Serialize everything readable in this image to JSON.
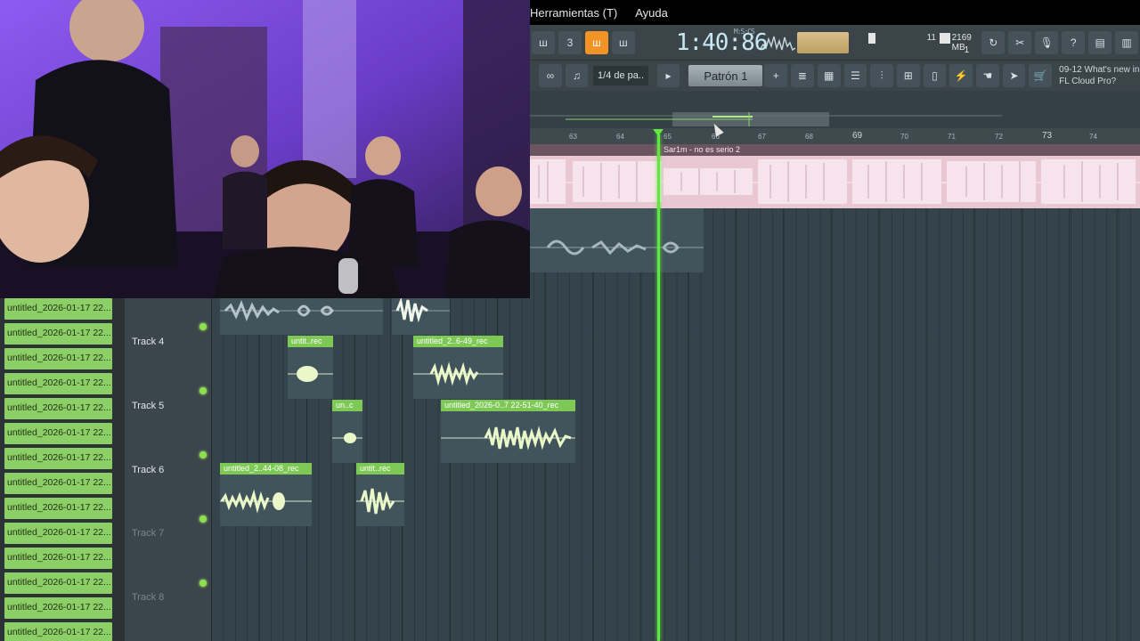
{
  "menu": {
    "items": [
      "Herramientas (T)",
      "Ayuda"
    ]
  },
  "transport": {
    "time": "1:40:86",
    "time_format": "M:S:CS",
    "cpu_value": "11",
    "memory": "2169 MB",
    "polyphony": "1"
  },
  "toolbar2": {
    "snap_label": "1/4 de pa..",
    "pattern_label": "Patrón 1",
    "pattern_add": "+",
    "news_date": "09-12",
    "news_text": "What's new in FL Cloud Pro?"
  },
  "ruler": {
    "bars": [
      "63",
      "64",
      "65",
      "66",
      "67",
      "68",
      "69",
      "70",
      "71",
      "72",
      "73",
      "74"
    ]
  },
  "master_clip": {
    "label": "Sar1m - no es serio 2"
  },
  "sidebar": {
    "items": [
      "untitled_2026-01-17 22...",
      "untitled_2026-01-17 22...",
      "untitled_2026-01-17 22...",
      "untitled_2026-01-17 22...",
      "untitled_2026-01-17 22...",
      "untitled_2026-01-17 22...",
      "untitled_2026-01-17 22...",
      "untitled_2026-01-17 22...",
      "untitled_2026-01-17 22...",
      "untitled_2026-01-17 22...",
      "untitled_2026-01-17 22...",
      "untitled_2026-01-17 22...",
      "untitled_2026-01-17 22...",
      "untitled_2026-01-17 22..."
    ]
  },
  "tracks": [
    {
      "name": "Track 4"
    },
    {
      "name": "Track 5"
    },
    {
      "name": "Track 6"
    },
    {
      "name": "Track 7"
    },
    {
      "name": "Track 8"
    }
  ],
  "clips": {
    "t4a": "untit..rec",
    "t4b": "untitled_2..6-49_rec",
    "t5a": "un..c",
    "t5b": "untitled_2026-0..7 22-51-40_rec",
    "t6a": "untitled_2..44-08_rec",
    "t6b": "untit..rec"
  },
  "colors": {
    "accent_green": "#7ec956",
    "playhead": "#5fe83d",
    "master_clip": "#e9c7d3",
    "tempo_orange": "#f29425"
  }
}
